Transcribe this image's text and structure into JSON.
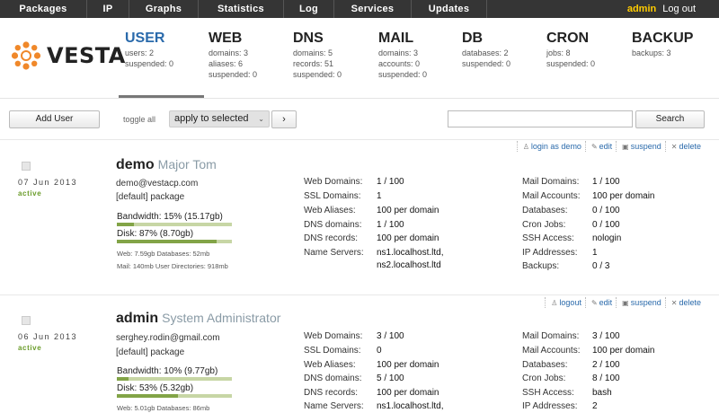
{
  "nav": {
    "tabs": [
      "Packages",
      "IP",
      "Graphs",
      "Statistics",
      "Log",
      "Services",
      "Updates"
    ],
    "user": "admin",
    "logout": "Log out"
  },
  "brand": "VESTA",
  "stats": [
    {
      "title": "USER",
      "lines": [
        "users: 2",
        "suspended: 0"
      ]
    },
    {
      "title": "WEB",
      "lines": [
        "domains: 3",
        "aliases: 6",
        "suspended: 0"
      ]
    },
    {
      "title": "DNS",
      "lines": [
        "domains: 5",
        "records: 51",
        "suspended: 0"
      ]
    },
    {
      "title": "MAIL",
      "lines": [
        "domains: 3",
        "accounts: 0",
        "suspended: 0"
      ]
    },
    {
      "title": "DB",
      "lines": [
        "databases: 2",
        "suspended: 0"
      ]
    },
    {
      "title": "CRON",
      "lines": [
        "jobs: 8",
        "suspended: 0"
      ]
    },
    {
      "title": "BACKUP",
      "lines": [
        "backups: 3"
      ]
    }
  ],
  "toolbar": {
    "add_user": "Add User",
    "toggle_all": "toggle all",
    "bulk_action": "apply to selected",
    "go": "›",
    "search": "Search"
  },
  "users": [
    {
      "actions": [
        "login as demo",
        "edit",
        "suspend",
        "delete"
      ],
      "date": "07 Jun 2013",
      "status": "active",
      "username": "demo",
      "fullname": "Major Tom",
      "email": "demo@vestacp.com",
      "package": "[default] package",
      "bandwidth_label": "Bandwidth: 15% (15.17gb)",
      "bandwidth_pct": 15,
      "disk_label": "Disk: 87% (8.70gb)",
      "disk_pct": 87,
      "usage1": "Web: 7.59gb  Databases: 52mb",
      "usage2": "Mail: 140mb  User Directories: 918mb",
      "col1": [
        {
          "k": "Web Domains:",
          "v": "1 / 100"
        },
        {
          "k": "SSL Domains:",
          "v": "1"
        },
        {
          "k": "Web Aliases:",
          "v": "100 per domain"
        },
        {
          "k": "DNS domains:",
          "v": "1 / 100"
        },
        {
          "k": "DNS records:",
          "v": "100 per domain"
        },
        {
          "k": "Name Servers:",
          "v": "ns1.localhost.ltd,",
          "v2": "ns2.localhost.ltd"
        }
      ],
      "col2": [
        {
          "k": "Mail Domains:",
          "v": "1 / 100"
        },
        {
          "k": "Mail Accounts:",
          "v": "100 per domain"
        },
        {
          "k": "Databases:",
          "v": "0 / 100"
        },
        {
          "k": "Cron Jobs:",
          "v": "0 / 100"
        },
        {
          "k": "SSH Access:",
          "v": "nologin"
        },
        {
          "k": "IP Addresses:",
          "v": "1"
        },
        {
          "k": "Backups:",
          "v": "0 / 3"
        }
      ]
    },
    {
      "actions": [
        "logout",
        "edit",
        "suspend",
        "delete"
      ],
      "date": "06 Jun 2013",
      "status": "active",
      "username": "admin",
      "fullname": "System Administrator",
      "email": "serghey.rodin@gmail.com",
      "package": "[default] package",
      "bandwidth_label": "Bandwidth: 10% (9.77gb)",
      "bandwidth_pct": 10,
      "disk_label": "Disk: 53% (5.32gb)",
      "disk_pct": 53,
      "usage1": "Web: 5.01gb  Databases: 86mb",
      "col1": [
        {
          "k": "Web Domains:",
          "v": "3 / 100"
        },
        {
          "k": "SSL Domains:",
          "v": "0"
        },
        {
          "k": "Web Aliases:",
          "v": "100 per domain"
        },
        {
          "k": "DNS domains:",
          "v": "5 / 100"
        },
        {
          "k": "DNS records:",
          "v": "100 per domain"
        },
        {
          "k": "Name Servers:",
          "v": "ns1.localhost.ltd,"
        }
      ],
      "col2": [
        {
          "k": "Mail Domains:",
          "v": "3 / 100"
        },
        {
          "k": "Mail Accounts:",
          "v": "100 per domain"
        },
        {
          "k": "Databases:",
          "v": "2 / 100"
        },
        {
          "k": "Cron Jobs:",
          "v": "8 / 100"
        },
        {
          "k": "SSH Access:",
          "v": "bash"
        },
        {
          "k": "IP Addresses:",
          "v": "2"
        }
      ]
    }
  ]
}
